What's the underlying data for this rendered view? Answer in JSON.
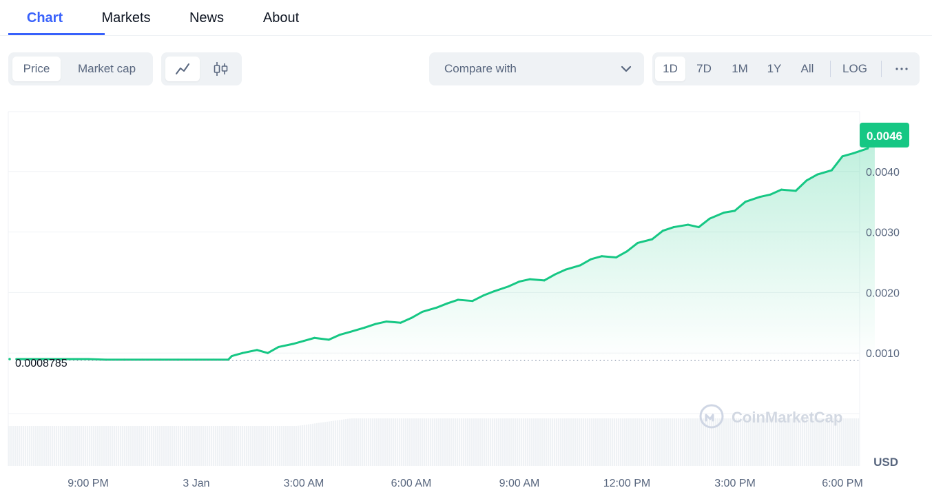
{
  "tabs": [
    {
      "label": "Chart",
      "active": true
    },
    {
      "label": "Markets",
      "active": false
    },
    {
      "label": "News",
      "active": false
    },
    {
      "label": "About",
      "active": false
    }
  ],
  "controls": {
    "metric": [
      {
        "label": "Price",
        "active": true
      },
      {
        "label": "Market cap",
        "active": false
      }
    ],
    "chart_style": [
      {
        "icon": "line-chart-icon",
        "active": true
      },
      {
        "icon": "candlestick-icon",
        "active": false
      }
    ],
    "compare_label": "Compare with",
    "ranges": [
      {
        "label": "1D",
        "active": true
      },
      {
        "label": "7D",
        "active": false
      },
      {
        "label": "1M",
        "active": false
      },
      {
        "label": "1Y",
        "active": false
      },
      {
        "label": "All",
        "active": false
      }
    ],
    "log_label": "LOG",
    "more_icon": "more-horizontal-icon"
  },
  "chart_data": {
    "type": "line",
    "currency": "USD",
    "current_price_label": "0.0046",
    "open_price_label": "0.0008785",
    "open_price": 0.0008785,
    "y_ticks": [
      {
        "value": 0.001,
        "label": "0.0010"
      },
      {
        "value": 0.002,
        "label": "0.0020"
      },
      {
        "value": 0.003,
        "label": "0.0030"
      },
      {
        "value": 0.004,
        "label": "0.0040"
      }
    ],
    "x_ticks": [
      "9:00 PM",
      "3 Jan",
      "3:00 AM",
      "6:00 AM",
      "9:00 AM",
      "12:00 PM",
      "3:00 PM",
      "6:00 PM"
    ],
    "ylim": [
      0.0,
      0.00465
    ],
    "watermark": "CoinMarketCap",
    "colors": {
      "up": "#16c784",
      "down": "#ea3943",
      "fill_top": "#16c784"
    },
    "x_hours": [
      0.0,
      0.5,
      1.0,
      1.5,
      2.0,
      2.5,
      3.0,
      3.5,
      4.0,
      4.5,
      5.0,
      5.5,
      5.9,
      6.0,
      6.3,
      6.7,
      7.0,
      7.3,
      7.7,
      8.0,
      8.3,
      8.7,
      9.0,
      9.3,
      9.7,
      10.0,
      10.3,
      10.7,
      11.0,
      11.3,
      11.7,
      12.0,
      12.3,
      12.7,
      13.0,
      13.3,
      13.7,
      14.0,
      14.3,
      14.7,
      15.0,
      15.3,
      15.7,
      16.0,
      16.3,
      16.7,
      17.0,
      17.3,
      17.7,
      18.0,
      18.3,
      18.7,
      19.0,
      19.3,
      19.7,
      20.0,
      20.3,
      20.7,
      21.0,
      21.3,
      21.7,
      22.0,
      22.3,
      22.7,
      23.0,
      23.3,
      23.7,
      23.9
    ],
    "prices": [
      0.0009,
      0.0009,
      0.0009,
      0.0009,
      0.0009,
      0.00089,
      0.00089,
      0.00089,
      0.00089,
      0.00089,
      0.00089,
      0.00089,
      0.00089,
      0.00095,
      0.001,
      0.00105,
      0.001,
      0.0011,
      0.00115,
      0.0012,
      0.00125,
      0.00122,
      0.0013,
      0.00135,
      0.00142,
      0.00148,
      0.00152,
      0.0015,
      0.00158,
      0.00168,
      0.00175,
      0.00182,
      0.00188,
      0.00186,
      0.00195,
      0.00202,
      0.0021,
      0.00218,
      0.00222,
      0.0022,
      0.0023,
      0.00238,
      0.00245,
      0.00255,
      0.0026,
      0.00258,
      0.00268,
      0.00282,
      0.00288,
      0.00302,
      0.00308,
      0.00312,
      0.00308,
      0.00322,
      0.00332,
      0.00335,
      0.0035,
      0.00358,
      0.00362,
      0.0037,
      0.00368,
      0.00385,
      0.00395,
      0.00402,
      0.00425,
      0.0043,
      0.00438,
      0.0046
    ]
  }
}
